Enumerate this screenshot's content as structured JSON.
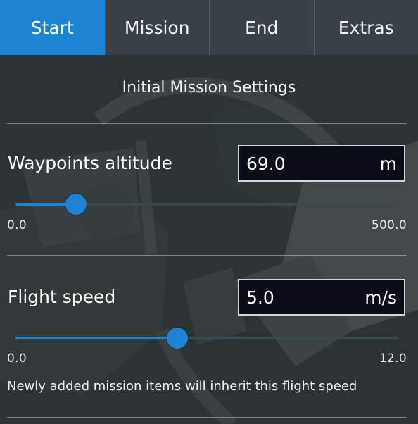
{
  "tabs": [
    {
      "label": "Start",
      "active": true
    },
    {
      "label": "Mission",
      "active": false
    },
    {
      "label": "End",
      "active": false
    },
    {
      "label": "Extras",
      "active": false
    }
  ],
  "section": {
    "title": "Initial Mission Settings"
  },
  "waypoints_altitude": {
    "label": "Waypoints altitude",
    "value": "69.0",
    "unit": "m",
    "min_label": "0.0",
    "max_label": "500.0",
    "slider_fraction": 0.158
  },
  "flight_speed": {
    "label": "Flight speed",
    "value": "5.0",
    "unit": "m/s",
    "min_label": "0.0",
    "max_label": "12.0",
    "slider_fraction": 0.422,
    "note": "Newly added mission items will inherit this flight speed"
  },
  "colors": {
    "accent": "#1f83d4",
    "tab_bar": "#3a4048",
    "input_bg": "#0a0d18"
  }
}
